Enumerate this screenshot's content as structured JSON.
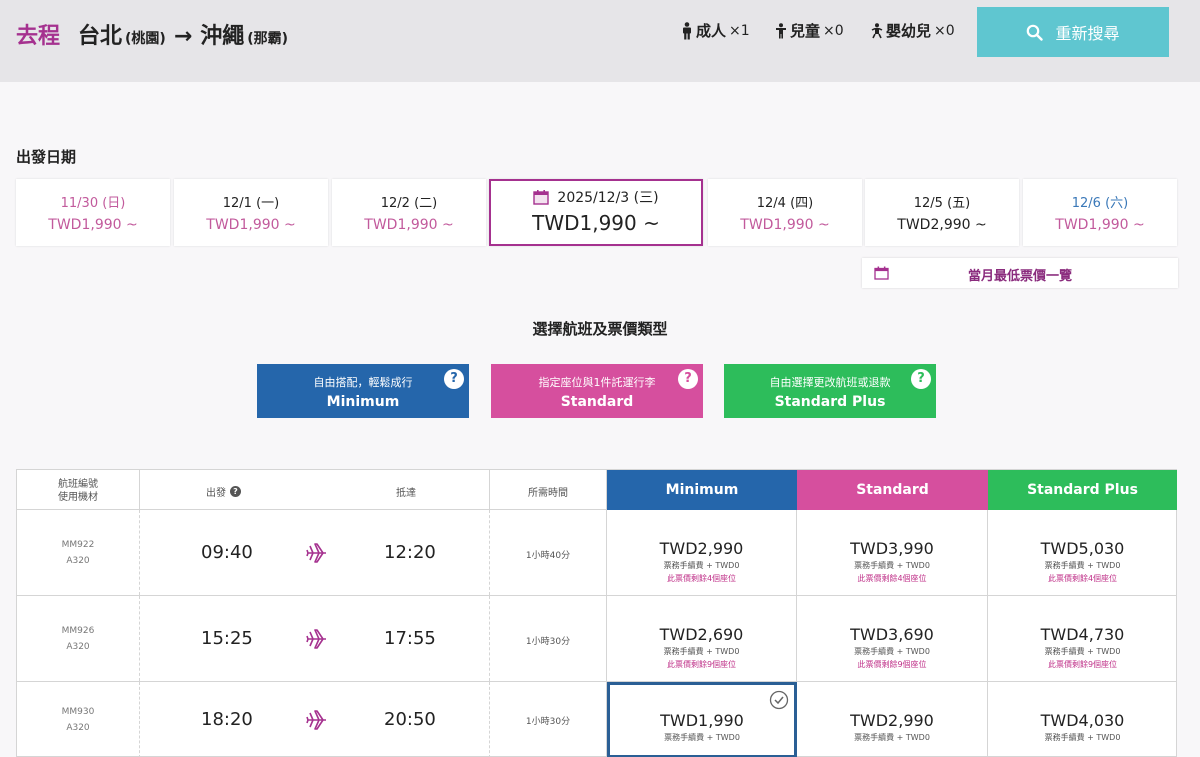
{
  "header": {
    "direction": "去程",
    "origin": "台北",
    "origin_airport": "(桃園)",
    "arrow": "→",
    "destination": "沖繩",
    "destination_airport": "(那霸)",
    "passengers": [
      {
        "label": "成人",
        "count": "×1",
        "icon": "adult-icon"
      },
      {
        "label": "兒童",
        "count": "×0",
        "icon": "child-icon"
      },
      {
        "label": "嬰幼兒",
        "count": "×0",
        "icon": "infant-icon"
      }
    ],
    "search_button": "重新搜尋"
  },
  "departure_label": "出發日期",
  "dates": [
    {
      "date": "11/30 (日)",
      "price": "TWD1,990 ~"
    },
    {
      "date": "12/1 (一)",
      "price": "TWD1,990 ~"
    },
    {
      "date": "12/2 (二)",
      "price": "TWD1,990 ~"
    },
    {
      "date": "2025/12/3 (三)",
      "price": "TWD1,990 ~"
    },
    {
      "date": "12/4 (四)",
      "price": "TWD1,990 ~"
    },
    {
      "date": "12/5 (五)",
      "price": "TWD2,990 ~"
    },
    {
      "date": "12/6 (六)",
      "price": "TWD1,990 ~"
    }
  ],
  "lowest_fare_button": "當月最低票價一覽",
  "select_title": "選擇航班及票價類型",
  "fare_types": [
    {
      "subtitle": "自由搭配，輕鬆成行",
      "name": "Minimum"
    },
    {
      "subtitle": "指定座位與1件託運行李",
      "name": "Standard"
    },
    {
      "subtitle": "自由選擇更改航班或退款",
      "name": "Standard Plus"
    }
  ],
  "table": {
    "col_flight_line1": "航班編號",
    "col_flight_line2": "使用機材",
    "col_depart": "出發",
    "col_arrive": "抵達",
    "col_duration": "所需時間",
    "col_minimum": "Minimum",
    "col_standard": "Standard",
    "col_plus": "Standard Plus",
    "rows": [
      {
        "flight": "MM922",
        "aircraft": "A320",
        "depart": "09:40",
        "arrive": "12:20",
        "duration": "1小時40分",
        "fares": [
          {
            "price": "TWD2,990",
            "fee": "票務手續費 + TWD0",
            "seats": "此票價剩餘4個座位"
          },
          {
            "price": "TWD3,990",
            "fee": "票務手續費 + TWD0",
            "seats": "此票價剩餘4個座位"
          },
          {
            "price": "TWD5,030",
            "fee": "票務手續費 + TWD0",
            "seats": "此票價剩餘4個座位"
          }
        ]
      },
      {
        "flight": "MM926",
        "aircraft": "A320",
        "depart": "15:25",
        "arrive": "17:55",
        "duration": "1小時30分",
        "fares": [
          {
            "price": "TWD2,690",
            "fee": "票務手續費 + TWD0",
            "seats": "此票價剩餘9個座位"
          },
          {
            "price": "TWD3,690",
            "fee": "票務手續費 + TWD0",
            "seats": "此票價剩餘9個座位"
          },
          {
            "price": "TWD4,730",
            "fee": "票務手續費 + TWD0",
            "seats": "此票價剩餘9個座位"
          }
        ]
      },
      {
        "flight": "MM930",
        "aircraft": "A320",
        "depart": "18:20",
        "arrive": "20:50",
        "duration": "1小時30分",
        "fares": [
          {
            "price": "TWD1,990",
            "fee": "票務手續費 + TWD0"
          },
          {
            "price": "TWD2,990",
            "fee": "票務手續費 + TWD0"
          },
          {
            "price": "TWD4,030",
            "fee": "票務手續費 + TWD0"
          }
        ]
      }
    ]
  },
  "colors": {
    "brand_purple": "#a5318f",
    "minimum_blue": "#2566ab",
    "standard_pink": "#d64f9e",
    "plus_green": "#2dbd5b",
    "search_teal": "#5fc6d0"
  }
}
